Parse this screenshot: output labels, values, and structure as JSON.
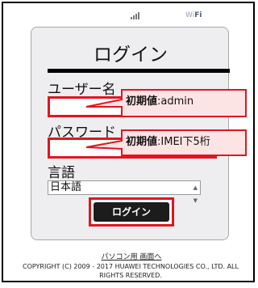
{
  "status_bar": {
    "signal_icon": "signal-bars-icon",
    "wifi": {
      "prefix": "Wi",
      "suffix": "Fi"
    }
  },
  "login": {
    "title": "ログイン",
    "username_label": "ユーザー名",
    "username_value": "",
    "password_label": "パスワード",
    "password_value": "",
    "language_label": "言語",
    "language_selected": "日本語",
    "submit_label": "ログイン"
  },
  "callouts": {
    "username": {
      "heading": "初期値",
      "value": ":admin"
    },
    "password": {
      "heading": "初期値",
      "value": ":IMEI下5桁"
    }
  },
  "footer": {
    "pc_link": "パソコン用 画面へ",
    "copyright": "COPYRIGHT (C) 2009 - 2017 HUAWEI TECHNOLOGIES CO., LTD. ALL RIGHTS RESERVED."
  },
  "colors": {
    "highlight": "#e0161f",
    "callout_fill": "#fde4e4",
    "card_bg": "#eeeef0",
    "button_bg": "#1c1c1c"
  }
}
